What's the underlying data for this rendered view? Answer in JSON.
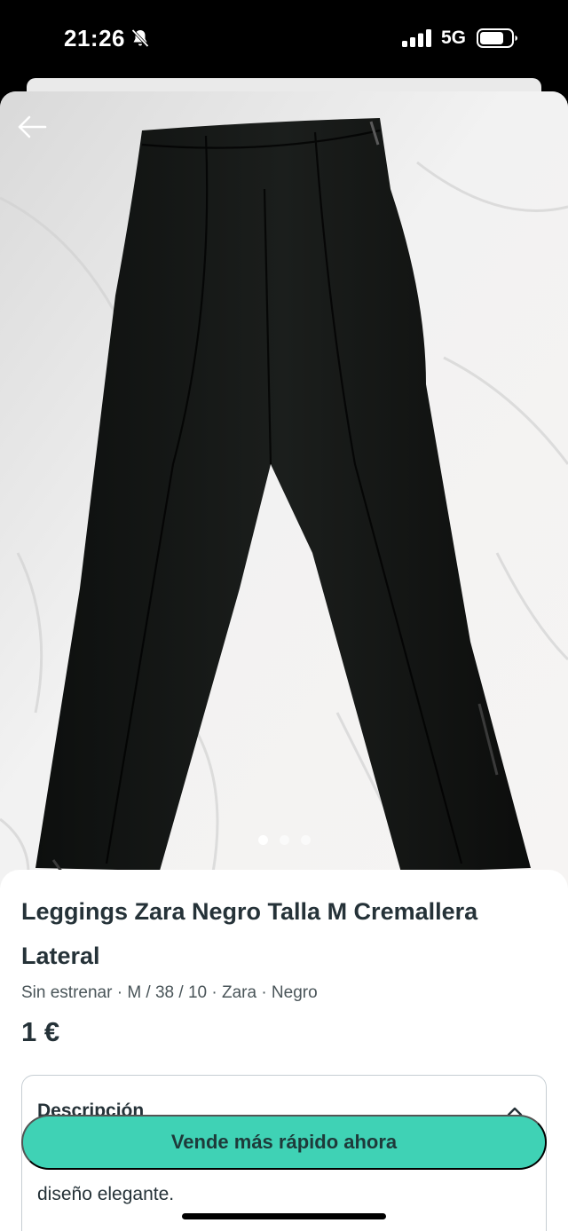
{
  "status_bar": {
    "time": "21:26",
    "network": "5G",
    "icons": [
      "bell-slash-icon",
      "signal-icon",
      "battery-icon"
    ]
  },
  "photo": {
    "subject": "black-leggings-on-white-sheet",
    "pagination": {
      "total": 3,
      "active": 1
    }
  },
  "product": {
    "title": "Leggings Zara Negro Talla M Cremallera Lateral",
    "meta": "Sin estrenar · M / 38 / 10 · Zara · Negro",
    "price": "1 €"
  },
  "description": {
    "heading": "Descripción",
    "text": "diseño elegante."
  },
  "cta": {
    "label": "Vende más rápido ahora",
    "color": "#3fd2b5"
  }
}
